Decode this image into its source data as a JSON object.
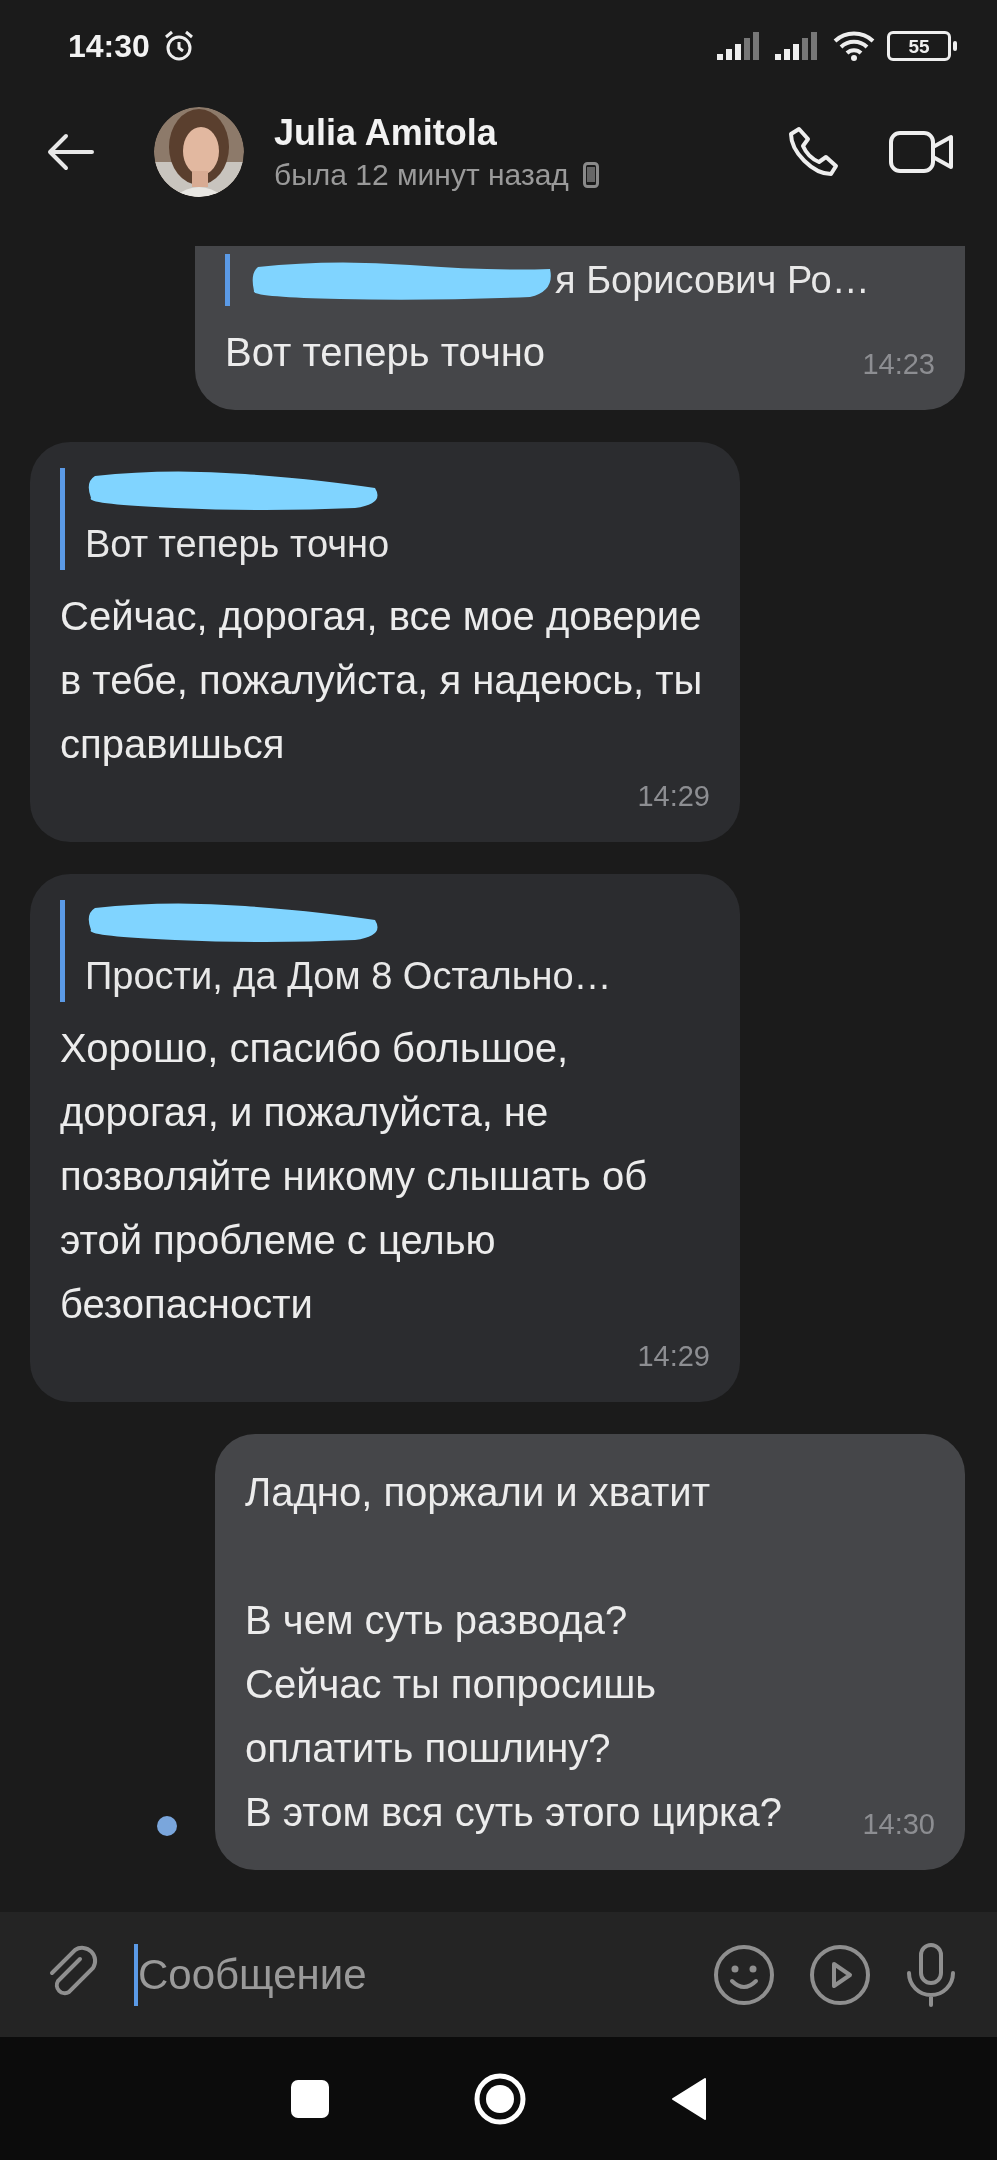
{
  "status_bar": {
    "time": "14:30",
    "battery": "55"
  },
  "header": {
    "name": "Julia Amitola",
    "status": "была 12 минут назад"
  },
  "messages": [
    {
      "outgoing": true,
      "quote": {
        "text_redacted": true,
        "text": "я Борисович  Ро…"
      },
      "text": "Вот теперь точно",
      "time": "14:23"
    },
    {
      "outgoing": false,
      "quote": {
        "author_redacted": true,
        "text": "Вот теперь точно"
      },
      "text": "Сейчас, дорогая, все мое доверие в тебе, пожалуйста, я надеюсь, ты справишься",
      "time": "14:29"
    },
    {
      "outgoing": false,
      "quote": {
        "author_redacted": true,
        "text": "Прости, да  Дом 8  Остально…"
      },
      "text": "Хорошо, спасибо большое, дорогая, и пожалуйста, не позволяйте никому слышать об этой проблеме с целью безопасности",
      "time": "14:29"
    },
    {
      "outgoing": true,
      "text": "Ладно, поржали и хватит\n\nВ чем суть развода?\nСейчас ты попросишь\nоплатить пошлину?\nВ этом вся суть этого цирка?",
      "time": "14:30",
      "unread": true
    }
  ],
  "composer": {
    "placeholder": "Сообщение"
  }
}
